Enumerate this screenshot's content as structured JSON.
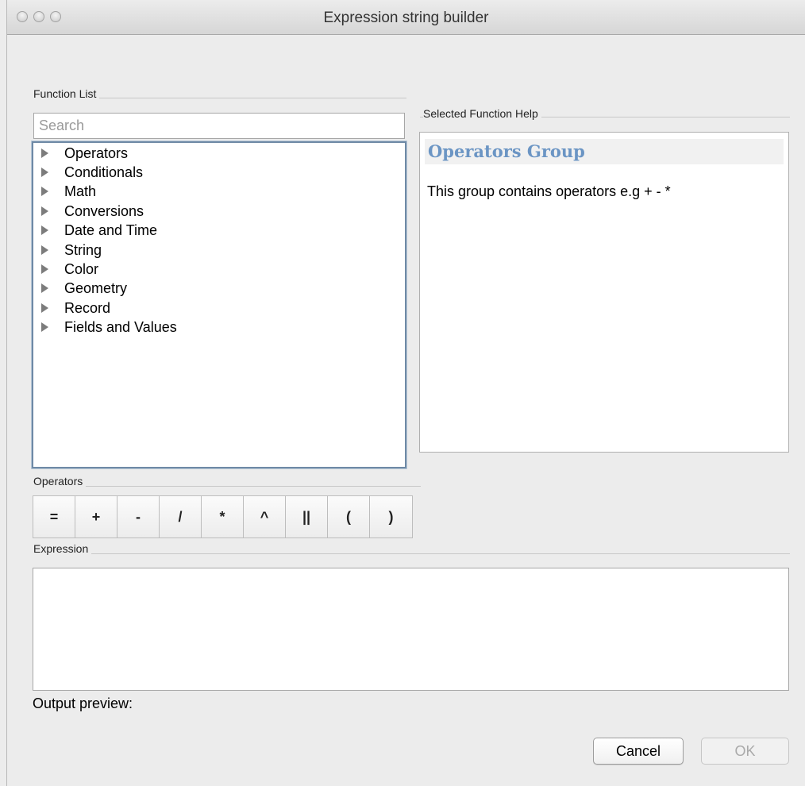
{
  "window": {
    "title": "Expression string builder"
  },
  "function_list": {
    "label": "Function List",
    "search_placeholder": "Search",
    "items": [
      {
        "label": "Operators"
      },
      {
        "label": "Conditionals"
      },
      {
        "label": "Math"
      },
      {
        "label": "Conversions"
      },
      {
        "label": "Date and Time"
      },
      {
        "label": "String"
      },
      {
        "label": "Color"
      },
      {
        "label": "Geometry"
      },
      {
        "label": "Record"
      },
      {
        "label": "Fields and Values"
      }
    ]
  },
  "help": {
    "label": "Selected Function Help",
    "title": "Operators Group",
    "text": "This group contains operators e.g + - *"
  },
  "operators": {
    "label": "Operators",
    "buttons": [
      "=",
      "+",
      "-",
      "/",
      "*",
      "^",
      "||",
      "(",
      ")"
    ]
  },
  "expression": {
    "label": "Expression",
    "value": ""
  },
  "output_preview": {
    "label": "Output preview:"
  },
  "buttons": {
    "cancel": "Cancel",
    "ok": "OK"
  }
}
